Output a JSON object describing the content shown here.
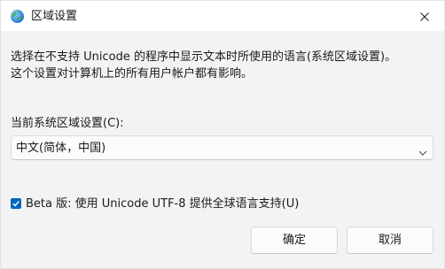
{
  "window": {
    "title": "区域设置",
    "icons": {
      "title": "globe-icon",
      "close": "close-icon"
    }
  },
  "content": {
    "description_line1": "选择在不支持 Unicode 的程序中显示文本时所使用的语言(系统区域设置)。",
    "description_line2": "这个设置对计算机上的所有用户帐户都有影响。",
    "locale_label": "当前系统区域设置(C):",
    "locale_select": {
      "selected": "中文(简体，中国)",
      "icon": "chevron-down-icon"
    },
    "utf8_checkbox": {
      "checked": true,
      "label": "Beta 版: 使用 Unicode UTF-8 提供全球语言支持(U)"
    }
  },
  "buttons": {
    "ok_label": "确定",
    "cancel_label": "取消"
  },
  "colors": {
    "accent": "#0067c0",
    "content_bg": "#f3f3f3",
    "title_bg": "#ffffff"
  }
}
